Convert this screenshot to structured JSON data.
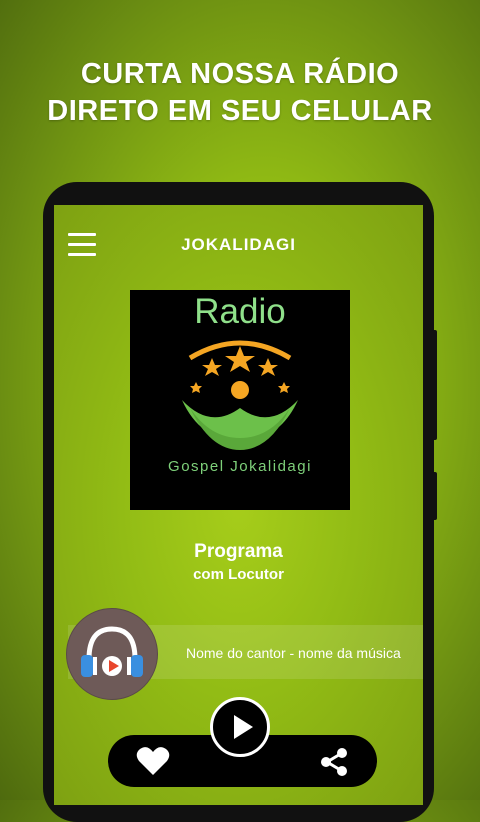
{
  "promo": {
    "line1": "CURTA NOSSA RÁDIO",
    "line2": "DIRETO EM SEU CELULAR"
  },
  "app_bar": {
    "title": "JOKALIDAGI",
    "menu_icon": "hamburger-menu-icon"
  },
  "logo": {
    "top_text": "Radio",
    "bottom_text": "Gospel Jokalidagi"
  },
  "program": {
    "name": "Programa",
    "host": "com Locutor"
  },
  "now_playing": {
    "text": "Nome do cantor - nome da música",
    "icon": "headphones-play-icon"
  },
  "controls": {
    "favorite_icon": "heart-icon",
    "play_icon": "play-icon",
    "share_icon": "share-icon"
  },
  "colors": {
    "background": "#8fb914",
    "logo_green": "#8fe08a",
    "star_orange": "#f5a623"
  }
}
